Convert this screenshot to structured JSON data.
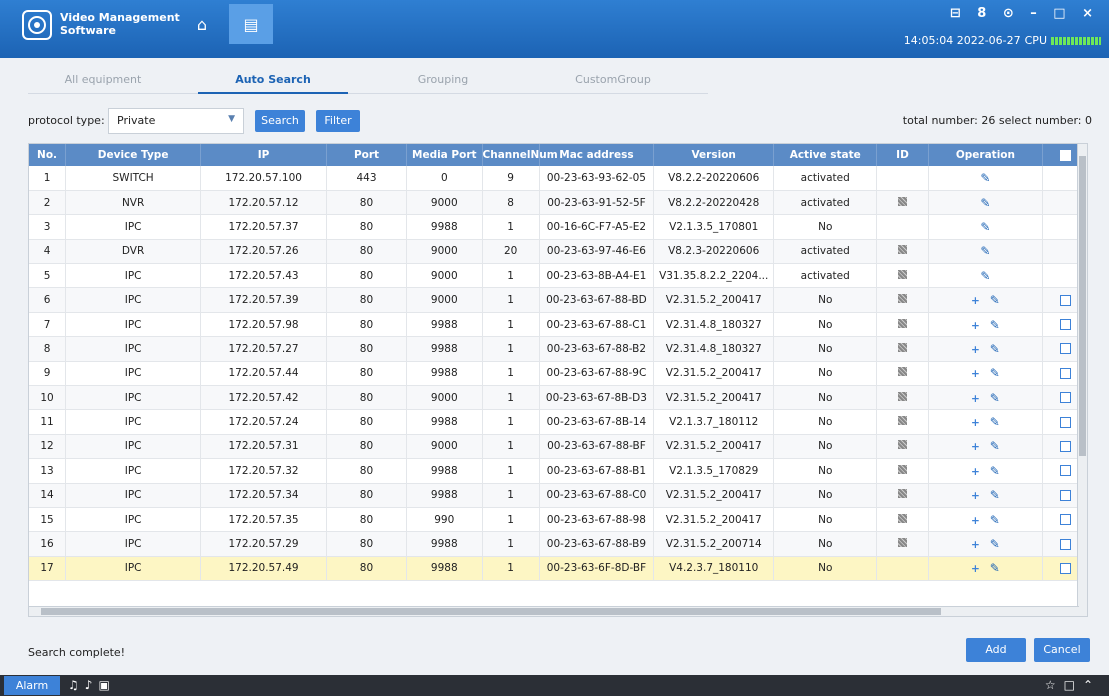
{
  "app": {
    "title_line1": "Video Management",
    "title_line2": "Software",
    "window_controls": "⊟ 8 ⊙ – □ ×",
    "clock": "14:05:04 2022-06-27",
    "cpu_label": "CPU"
  },
  "tabs": [
    {
      "label": "All equipment"
    },
    {
      "label": "Auto Search"
    },
    {
      "label": "Grouping"
    },
    {
      "label": "CustomGroup"
    }
  ],
  "toolbar": {
    "protocol_label": "protocol type:",
    "protocol_value": "Private",
    "search_label": "Search",
    "filter_label": "Filter",
    "totals": "total number: 26  select number: 0"
  },
  "table": {
    "columns": [
      "No.",
      "Device Type",
      "IP",
      "Port",
      "Media Port",
      "ChannelNum",
      "Mac address",
      "Version",
      "Active state",
      "ID",
      "Operation"
    ],
    "rows": [
      {
        "no": "1",
        "type": "SWITCH",
        "ip": "172.20.57.100",
        "port": "443",
        "media": "0",
        "ch": "9",
        "mac": "00-23-63-93-62-05",
        "ver": "V8.2.2-20220606",
        "state": "activated",
        "id": false,
        "plus": false,
        "check": false
      },
      {
        "no": "2",
        "type": "NVR",
        "ip": "172.20.57.12",
        "port": "80",
        "media": "9000",
        "ch": "8",
        "mac": "00-23-63-91-52-5F",
        "ver": "V8.2.2-20220428",
        "state": "activated",
        "id": true,
        "plus": false,
        "check": false
      },
      {
        "no": "3",
        "type": "IPC",
        "ip": "172.20.57.37",
        "port": "80",
        "media": "9988",
        "ch": "1",
        "mac": "00-16-6C-F7-A5-E2",
        "ver": "V2.1.3.5_170801",
        "state": "No",
        "id": false,
        "plus": false,
        "check": false
      },
      {
        "no": "4",
        "type": "DVR",
        "ip": "172.20.57.26",
        "port": "80",
        "media": "9000",
        "ch": "20",
        "mac": "00-23-63-97-46-E6",
        "ver": "V8.2.3-20220606",
        "state": "activated",
        "id": true,
        "plus": false,
        "check": false
      },
      {
        "no": "5",
        "type": "IPC",
        "ip": "172.20.57.43",
        "port": "80",
        "media": "9000",
        "ch": "1",
        "mac": "00-23-63-8B-A4-E1",
        "ver": "V31.35.8.2.2_2204...",
        "state": "activated",
        "id": true,
        "plus": false,
        "check": false
      },
      {
        "no": "6",
        "type": "IPC",
        "ip": "172.20.57.39",
        "port": "80",
        "media": "9000",
        "ch": "1",
        "mac": "00-23-63-67-88-BD",
        "ver": "V2.31.5.2_200417",
        "state": "No",
        "id": true,
        "plus": true,
        "check": true
      },
      {
        "no": "7",
        "type": "IPC",
        "ip": "172.20.57.98",
        "port": "80",
        "media": "9988",
        "ch": "1",
        "mac": "00-23-63-67-88-C1",
        "ver": "V2.31.4.8_180327",
        "state": "No",
        "id": true,
        "plus": true,
        "check": true
      },
      {
        "no": "8",
        "type": "IPC",
        "ip": "172.20.57.27",
        "port": "80",
        "media": "9988",
        "ch": "1",
        "mac": "00-23-63-67-88-B2",
        "ver": "V2.31.4.8_180327",
        "state": "No",
        "id": true,
        "plus": true,
        "check": true
      },
      {
        "no": "9",
        "type": "IPC",
        "ip": "172.20.57.44",
        "port": "80",
        "media": "9988",
        "ch": "1",
        "mac": "00-23-63-67-88-9C",
        "ver": "V2.31.5.2_200417",
        "state": "No",
        "id": true,
        "plus": true,
        "check": true
      },
      {
        "no": "10",
        "type": "IPC",
        "ip": "172.20.57.42",
        "port": "80",
        "media": "9000",
        "ch": "1",
        "mac": "00-23-63-67-8B-D3",
        "ver": "V2.31.5.2_200417",
        "state": "No",
        "id": true,
        "plus": true,
        "check": true
      },
      {
        "no": "11",
        "type": "IPC",
        "ip": "172.20.57.24",
        "port": "80",
        "media": "9988",
        "ch": "1",
        "mac": "00-23-63-67-8B-14",
        "ver": "V2.1.3.7_180112",
        "state": "No",
        "id": true,
        "plus": true,
        "check": true
      },
      {
        "no": "12",
        "type": "IPC",
        "ip": "172.20.57.31",
        "port": "80",
        "media": "9000",
        "ch": "1",
        "mac": "00-23-63-67-88-BF",
        "ver": "V2.31.5.2_200417",
        "state": "No",
        "id": true,
        "plus": true,
        "check": true
      },
      {
        "no": "13",
        "type": "IPC",
        "ip": "172.20.57.32",
        "port": "80",
        "media": "9988",
        "ch": "1",
        "mac": "00-23-63-67-88-B1",
        "ver": "V2.1.3.5_170829",
        "state": "No",
        "id": true,
        "plus": true,
        "check": true
      },
      {
        "no": "14",
        "type": "IPC",
        "ip": "172.20.57.34",
        "port": "80",
        "media": "9988",
        "ch": "1",
        "mac": "00-23-63-67-88-C0",
        "ver": "V2.31.5.2_200417",
        "state": "No",
        "id": true,
        "plus": true,
        "check": true
      },
      {
        "no": "15",
        "type": "IPC",
        "ip": "172.20.57.35",
        "port": "80",
        "media": "990",
        "ch": "1",
        "mac": "00-23-63-67-88-98",
        "ver": "V2.31.5.2_200417",
        "state": "No",
        "id": true,
        "plus": true,
        "check": true
      },
      {
        "no": "16",
        "type": "IPC",
        "ip": "172.20.57.29",
        "port": "80",
        "media": "9988",
        "ch": "1",
        "mac": "00-23-63-67-88-B9",
        "ver": "V2.31.5.2_200714",
        "state": "No",
        "id": true,
        "plus": true,
        "check": true
      },
      {
        "no": "17",
        "type": "IPC",
        "ip": "172.20.57.49",
        "port": "80",
        "media": "9988",
        "ch": "1",
        "mac": "00-23-63-6F-8D-BF",
        "ver": "V4.2.3.7_180110",
        "state": "No",
        "id": false,
        "plus": true,
        "check": true,
        "highlight": true
      }
    ]
  },
  "footer": {
    "message": "Search complete!",
    "add_label": "Add",
    "cancel_label": "Cancel"
  },
  "taskbar": {
    "alarm_label": "Alarm"
  },
  "colors": {
    "titlebar": "#1c63b4",
    "header": "#5b8bc6",
    "button": "#3d82d8",
    "highlight_row": "#fdf6c4"
  }
}
